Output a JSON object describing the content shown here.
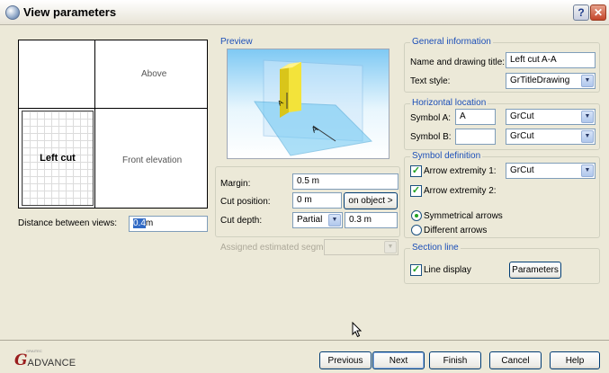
{
  "window": {
    "title": "View parameters",
    "help_label": "?",
    "close_label": "✕"
  },
  "layout_preview": {
    "cell_above": "Above",
    "cell_left_cut": "Left cut",
    "cell_front": "Front elevation"
  },
  "distance": {
    "label": "Distance between views:",
    "value": "0.4",
    "unit": "m"
  },
  "preview": {
    "title": "Preview"
  },
  "cut": {
    "margin_label": "Margin:",
    "margin_value": "0.5 m",
    "position_label": "Cut position:",
    "position_value": "0 m",
    "on_object_label": "on object >",
    "depth_label": "Cut depth:",
    "depth_mode": "Partial",
    "depth_value": "0.3 m",
    "segment_label": "Assigned estimated segment",
    "segment_value": ""
  },
  "general": {
    "title": "General information",
    "name_label": "Name and drawing title:",
    "name_value": "Left cut A-A",
    "text_style_label": "Text style:",
    "text_style_value": "GrTitleDrawing"
  },
  "horizontal": {
    "title": "Horizontal location",
    "symbol_a_label": "Symbol A:",
    "symbol_a_value": "A",
    "symbol_a_style": "GrCut",
    "symbol_b_label": "Symbol B:",
    "symbol_b_value": "",
    "symbol_b_style": "GrCut"
  },
  "symbol_def": {
    "title": "Symbol definition",
    "arrow1_label": "Arrow extremity 1:",
    "arrow1_checked": true,
    "arrow1_style": "GrCut",
    "arrow2_label": "Arrow extremity 2:",
    "arrow2_checked": true,
    "sym_label": "Symmetrical arrows",
    "diff_label": "Different arrows",
    "selected_arrows": "symmetrical"
  },
  "section_line": {
    "title": "Section line",
    "display_label": "Line display",
    "display_checked": true,
    "parameters_label": "Parameters"
  },
  "footer": {
    "logo_g": "G",
    "logo_text": "ADVANCE",
    "logo_small": "GRAITEC",
    "previous": "Previous",
    "next": "Next",
    "finish": "Finish",
    "cancel": "Cancel",
    "help": "Help"
  }
}
